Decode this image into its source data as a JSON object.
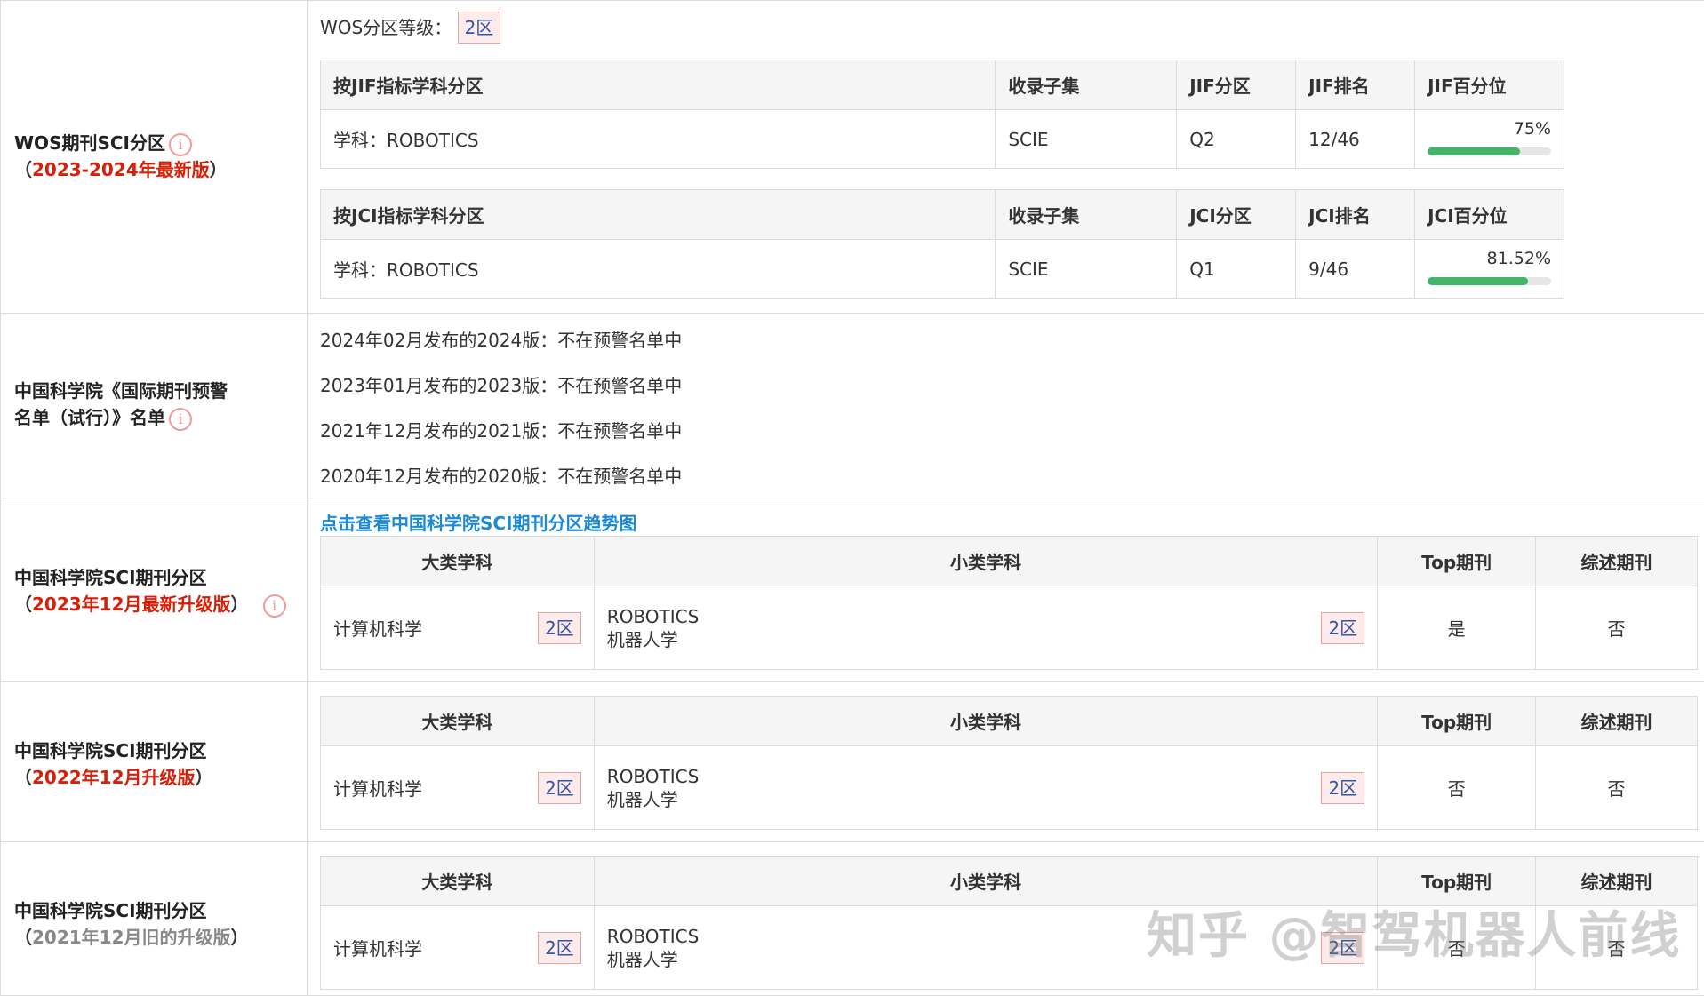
{
  "wos": {
    "label": "WOS期刊SCI分区",
    "version": "2023-2024年最新版",
    "grade_label": "WOS分区等级：",
    "grade": "2区",
    "jif": {
      "headers": [
        "按JIF指标学科分区",
        "收录子集",
        "JIF分区",
        "JIF排名",
        "JIF百分位"
      ],
      "subject": "学科：ROBOTICS",
      "subset": "SCIE",
      "quartile": "Q2",
      "rank": "12/46",
      "percentile_text": "75%",
      "percentile": 75
    },
    "jci": {
      "headers": [
        "按JCI指标学科分区",
        "收录子集",
        "JCI分区",
        "JCI排名",
        "JCI百分位"
      ],
      "subject": "学科：ROBOTICS",
      "subset": "SCIE",
      "quartile": "Q1",
      "rank": "9/46",
      "percentile_text": "81.52%",
      "percentile": 81.52
    }
  },
  "warning": {
    "label_line1": "中国科学院《国际期刊预警",
    "label_line2": "名单（试行）》名单",
    "items": [
      "2024年02月发布的2024版：不在预警名单中",
      "2023年01月发布的2023版：不在预警名单中",
      "2021年12月发布的2021版：不在预警名单中",
      "2020年12月发布的2020版：不在预警名单中"
    ]
  },
  "cas_link": "点击查看中国科学院SCI期刊分区趋势图",
  "cas_headers": [
    "大类学科",
    "小类学科",
    "Top期刊",
    "综述期刊"
  ],
  "cas": [
    {
      "label": "中国科学院SCI期刊分区",
      "version": "2023年12月最新升级版",
      "major": "计算机科学",
      "major_zone": "2区",
      "minor_en": "ROBOTICS",
      "minor_cn": "机器人学",
      "minor_zone": "2区",
      "top": "是",
      "review": "否"
    },
    {
      "label": "中国科学院SCI期刊分区",
      "version": "2022年12月升级版",
      "major": "计算机科学",
      "major_zone": "2区",
      "minor_en": "ROBOTICS",
      "minor_cn": "机器人学",
      "minor_zone": "2区",
      "top": "否",
      "review": "否"
    },
    {
      "label": "中国科学院SCI期刊分区",
      "version": "2021年12月旧的升级版",
      "major": "计算机科学",
      "major_zone": "2区",
      "minor_en": "ROBOTICS",
      "minor_cn": "机器人学",
      "minor_zone": "2区",
      "top": "否",
      "review": "否"
    }
  ],
  "watermark": "知乎 @智驾机器人前线"
}
